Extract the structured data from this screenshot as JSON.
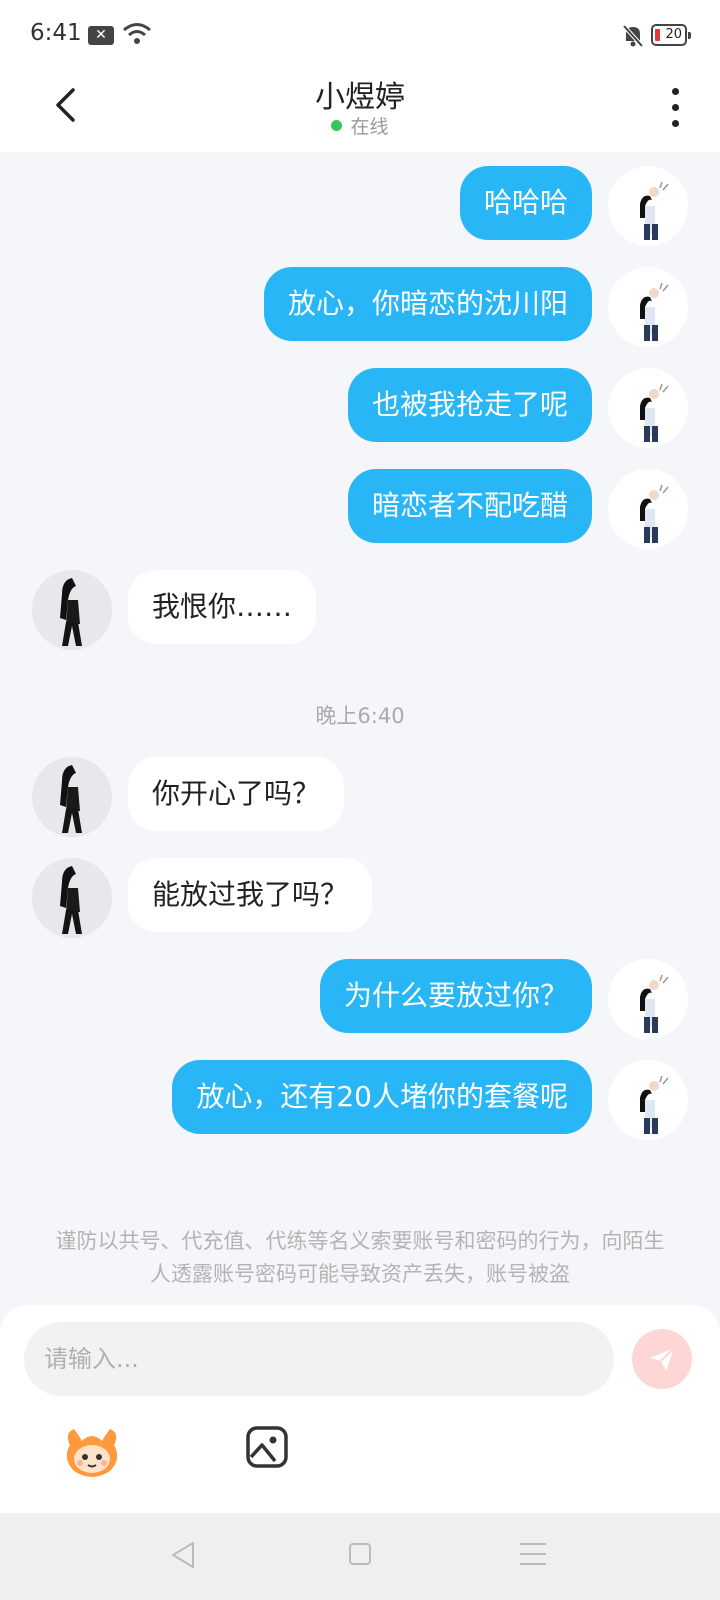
{
  "status_bar": {
    "time": "6:41",
    "battery": "20"
  },
  "header": {
    "title": "小煜婷",
    "status": "在线"
  },
  "messages": [
    {
      "text": "哈哈哈"
    },
    {
      "text": "放心，你暗恋的沈川阳"
    },
    {
      "text": "也被我抢走了呢"
    },
    {
      "text": "暗恋者不配吃醋"
    },
    {
      "text": "我恨你……"
    },
    {
      "text": "你开心了吗？"
    },
    {
      "text": "能放过我了吗？"
    },
    {
      "text": "为什么要放过你？"
    },
    {
      "text": "放心，还有20人堵你的套餐呢"
    }
  ],
  "timestamp": "晚上6:40",
  "warning": "谨防以共号、代充值、代练等名义索要账号和密码的行为，向陌生人透露账号密码可能导致资产丢失，账号被盗",
  "composer": {
    "placeholder": "请输入..."
  },
  "icons": {
    "back": "chevron-left-icon",
    "more": "more-vertical-icon",
    "send": "send-icon",
    "emoji": "emoji-mascot-icon",
    "image": "image-icon"
  },
  "colors": {
    "my_bubble": "#29b6f6",
    "their_bubble": "#ffffff",
    "online": "#35c759",
    "send_button": "#ffd6d6",
    "background": "#f4f6f9"
  }
}
